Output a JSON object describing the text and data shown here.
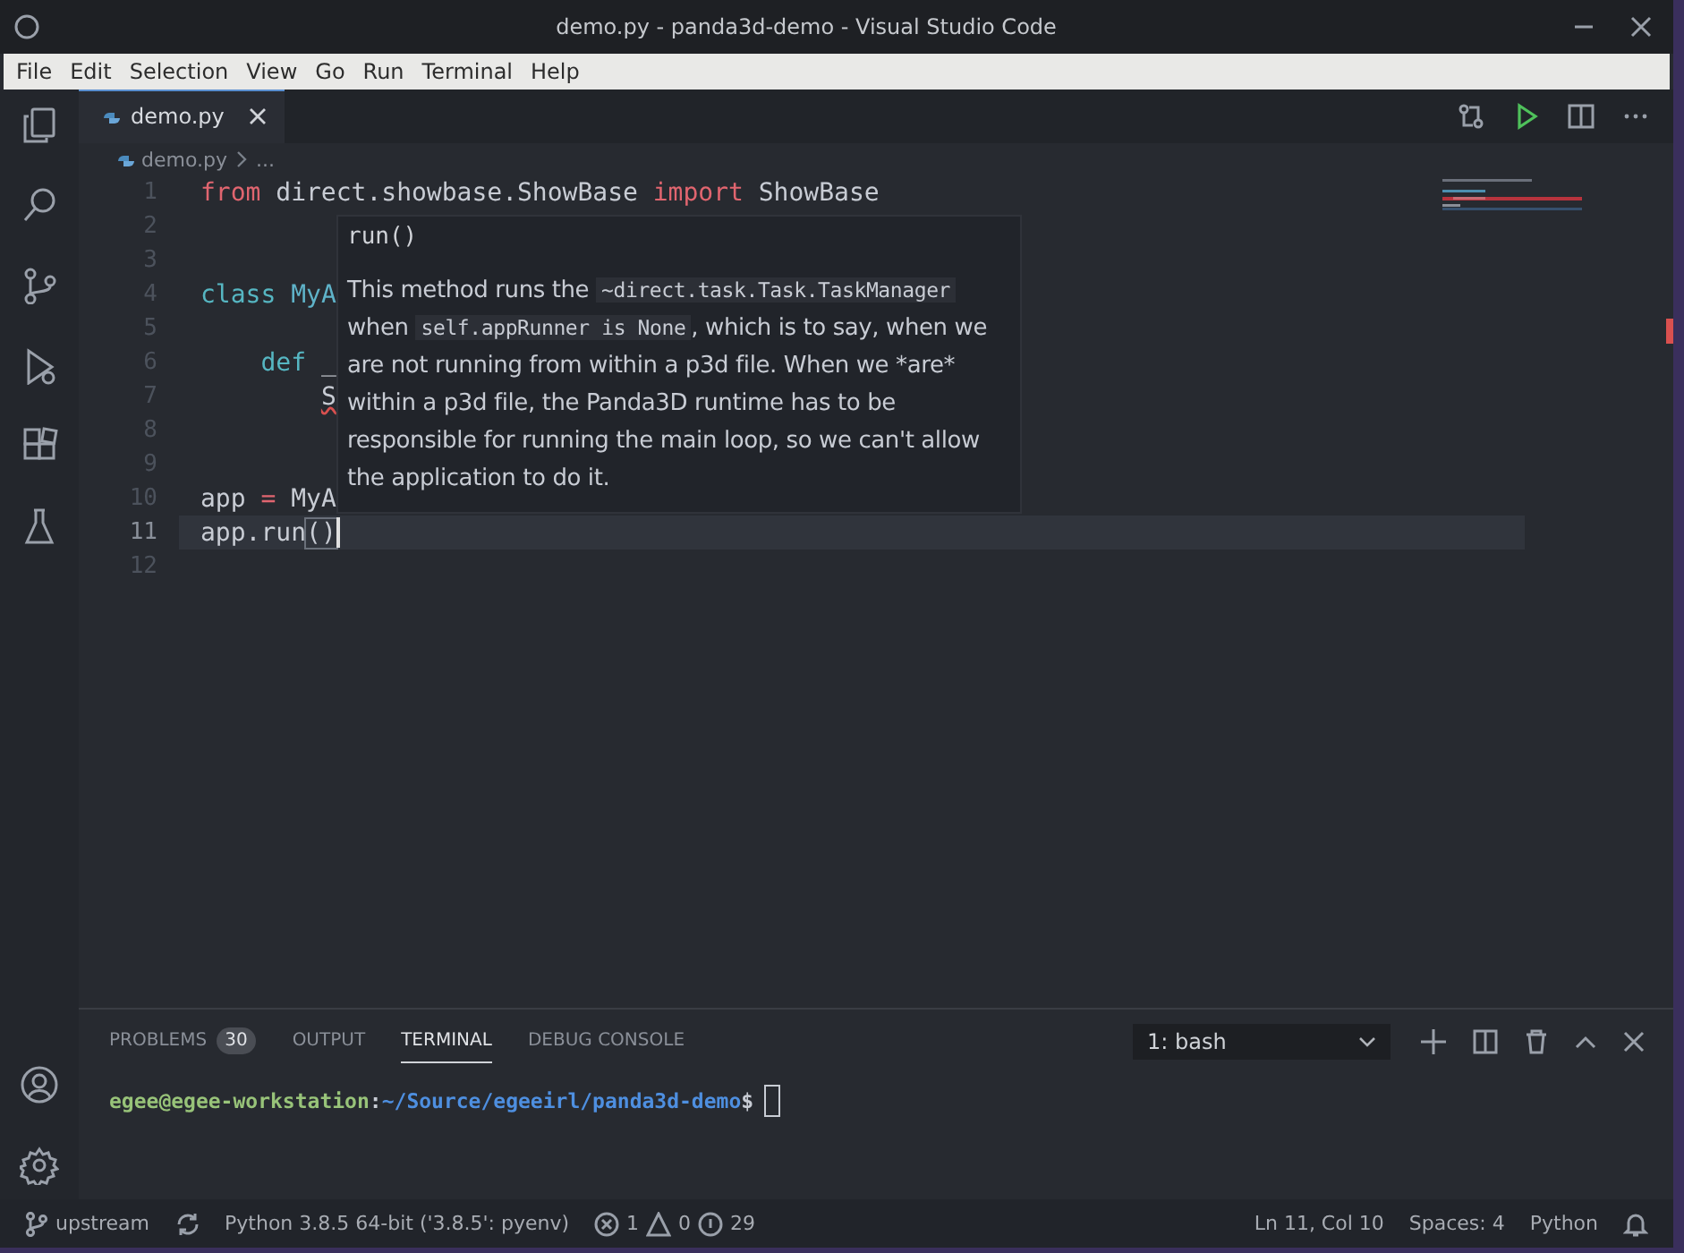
{
  "window": {
    "title": "demo.py - panda3d-demo - Visual Studio Code"
  },
  "menu": [
    "File",
    "Edit",
    "Selection",
    "View",
    "Go",
    "Run",
    "Terminal",
    "Help"
  ],
  "tabs": [
    {
      "label": "demo.py",
      "selected": true
    }
  ],
  "breadcrumb": [
    "demo.py",
    "..."
  ],
  "code_lines": [
    {
      "number": "1",
      "current": false,
      "tokens": [
        {
          "kind": "keyword",
          "text": "from"
        },
        {
          "kind": "plain",
          "text": " direct.showbase.ShowBase "
        },
        {
          "kind": "keyword",
          "text": "import"
        },
        {
          "kind": "plain",
          "text": " ShowBase"
        }
      ]
    },
    {
      "number": "2",
      "current": false
    },
    {
      "number": "3",
      "current": false
    },
    {
      "number": "4",
      "current": false,
      "tokens": [
        {
          "kind": "storage",
          "text": "class"
        },
        {
          "kind": "classname",
          "text": " MyA"
        }
      ]
    },
    {
      "number": "5",
      "current": false
    },
    {
      "number": "6",
      "current": false,
      "tokens": [
        {
          "kind": "storage",
          "text": "    def"
        },
        {
          "kind": "plain",
          "text": " _"
        }
      ]
    },
    {
      "number": "7",
      "current": false,
      "tokens": [
        {
          "kind": "error",
          "text": "        S"
        }
      ]
    },
    {
      "number": "8",
      "current": false
    },
    {
      "number": "9",
      "current": false
    },
    {
      "number": "10",
      "current": false,
      "tokens": [
        {
          "kind": "plain",
          "text": "app "
        },
        {
          "kind": "keyword",
          "text": "="
        },
        {
          "kind": "plain",
          "text": " MyA"
        }
      ]
    },
    {
      "number": "11",
      "current": true,
      "tokens": [
        {
          "kind": "plain",
          "text": "app.run"
        },
        {
          "kind": "bracket",
          "text": "()"
        }
      ]
    },
    {
      "number": "12",
      "current": false
    }
  ],
  "hover": {
    "signature": "run()",
    "body": [
      {
        "kind": "text",
        "text": "This method runs the "
      },
      {
        "kind": "code",
        "text": "~direct.task.Task.TaskManager"
      },
      {
        "kind": "text",
        "text": " when "
      },
      {
        "kind": "code",
        "text": "self.appRunner is None"
      },
      {
        "kind": "text",
        "text": ", which is to say, when we are not running from within a p3d file. When we *are* within a p3d file, the Panda3D runtime has to be responsible for running the main loop, so we can't allow the application to do it."
      }
    ]
  },
  "panel": {
    "tabs": [
      {
        "label": "PROBLEMS",
        "badge": "30",
        "selected": false
      },
      {
        "label": "OUTPUT",
        "selected": false
      },
      {
        "label": "TERMINAL",
        "selected": true
      },
      {
        "label": "DEBUG CONSOLE",
        "selected": false
      }
    ],
    "terminal_select": "1: bash",
    "prompt": {
      "user": "egee@egee-workstation",
      "separator": ":",
      "path": "~/Source/egeeirl/panda3d-demo",
      "symbol": "$"
    }
  },
  "status_bar": {
    "branch": "upstream",
    "interpreter": "Python 3.8.5 64-bit ('3.8.5': pyenv)",
    "errors": "1",
    "warnings": "0",
    "infos": "29",
    "position": "Ln 11, Col 10",
    "indentation": "Spaces: 4",
    "language": "Python"
  }
}
